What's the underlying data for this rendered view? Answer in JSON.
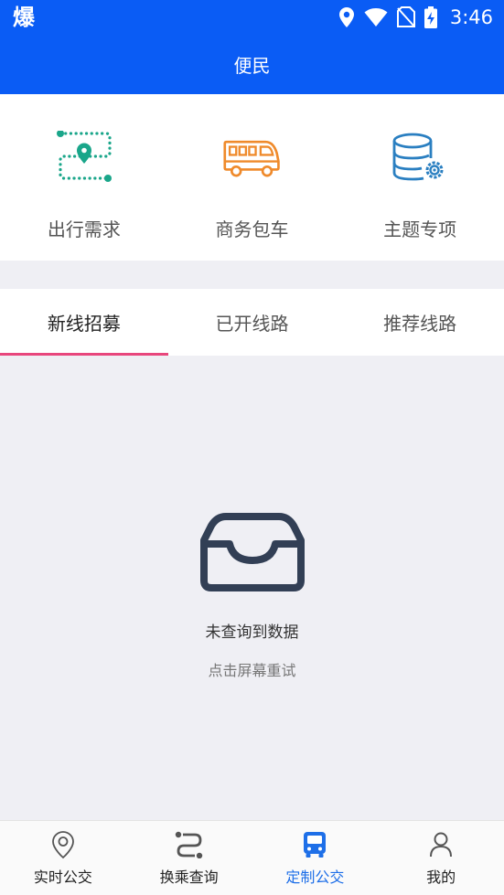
{
  "status_bar": {
    "app_glyph": "爆",
    "time": "3:46"
  },
  "header": {
    "title": "便民"
  },
  "services": [
    {
      "label": "出行需求",
      "icon": "route-map-icon",
      "color": "#1aa68a"
    },
    {
      "label": "商务包车",
      "icon": "bus-icon",
      "color": "#ef8a2b"
    },
    {
      "label": "主题专项",
      "icon": "database-settings-icon",
      "color": "#2a7fc1"
    }
  ],
  "tabs": [
    {
      "label": "新线招募",
      "active": true
    },
    {
      "label": "已开线路",
      "active": false
    },
    {
      "label": "推荐线路",
      "active": false
    }
  ],
  "empty_state": {
    "title": "未查询到数据",
    "hint": "点击屏幕重试",
    "icon": "inbox-icon"
  },
  "bottom_nav": [
    {
      "label": "实时公交",
      "icon": "location-pin-icon",
      "active": false
    },
    {
      "label": "换乘查询",
      "icon": "transfer-route-icon",
      "active": false
    },
    {
      "label": "定制公交",
      "icon": "bus-front-icon",
      "active": true,
      "active_color": "#1e6fe8"
    },
    {
      "label": "我的",
      "icon": "user-icon",
      "active": false
    }
  ]
}
